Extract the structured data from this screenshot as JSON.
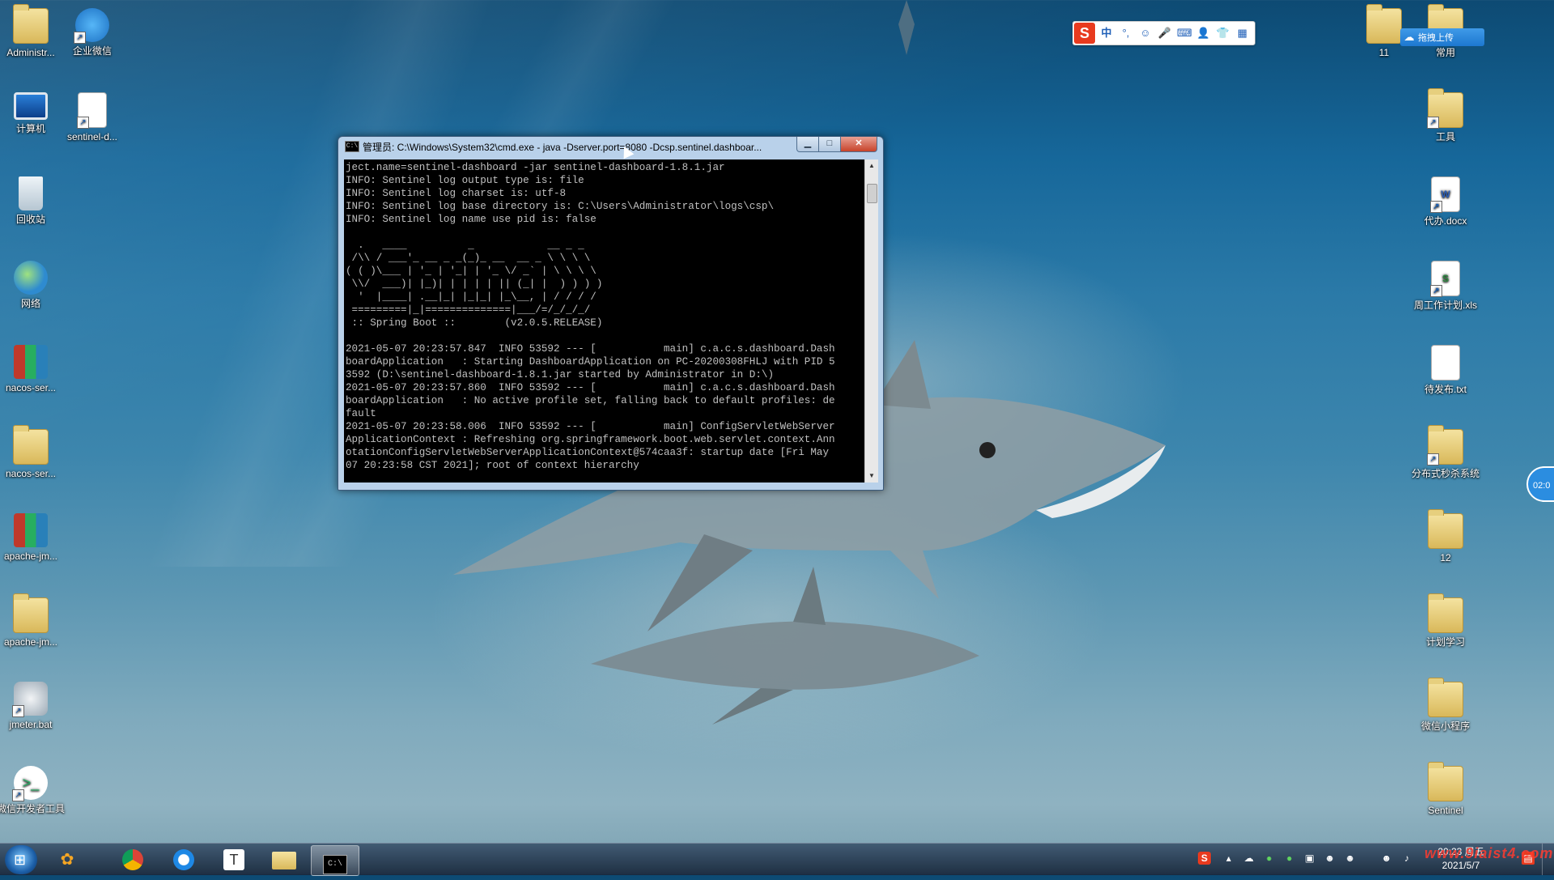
{
  "desktop": {
    "left_icons": [
      {
        "label": "Administr...",
        "kind": "folder"
      },
      {
        "label": "企业微信",
        "kind": "app"
      },
      {
        "label": "计算机",
        "kind": "computer"
      },
      {
        "label": "sentinel-d...",
        "kind": "doc"
      },
      {
        "label": "回收站",
        "kind": "recycle"
      },
      {
        "label": "网络",
        "kind": "network"
      },
      {
        "label": "nacos-ser...",
        "kind": "archive"
      },
      {
        "label": "nacos-ser...",
        "kind": "folder"
      },
      {
        "label": "apache-jm...",
        "kind": "archive"
      },
      {
        "label": "apache-jm...",
        "kind": "folder"
      },
      {
        "label": "jmeter.bat",
        "kind": "bat"
      },
      {
        "label": "微信开发者工具",
        "kind": "app"
      }
    ],
    "right_icons": [
      {
        "label": "11",
        "kind": "folder"
      },
      {
        "label": "常用",
        "kind": "folder"
      },
      {
        "label": "工具",
        "kind": "folder"
      },
      {
        "label": "代办.docx",
        "kind": "word"
      },
      {
        "label": "周工作计划.xls",
        "kind": "excel"
      },
      {
        "label": "待发布.txt",
        "kind": "txt"
      },
      {
        "label": "分布式秒杀系统",
        "kind": "folder"
      },
      {
        "label": "12",
        "kind": "folder"
      },
      {
        "label": "计划学习",
        "kind": "folder"
      },
      {
        "label": "微信小程序",
        "kind": "folder"
      },
      {
        "label": "Sentinel",
        "kind": "folder"
      }
    ]
  },
  "cloud_upload": {
    "label": "拖拽上传"
  },
  "ring_button": {
    "label": "02:0"
  },
  "ime": {
    "items": [
      "中",
      "°,",
      "☺",
      "🎤",
      "⌨",
      "👤",
      "👕",
      "▦"
    ]
  },
  "cmd_window": {
    "title": "管理员: C:\\Windows\\System32\\cmd.exe - java  -Dserver.port=8080 -Dcsp.sentinel.dashboar...",
    "console_text": "ject.name=sentinel-dashboard -jar sentinel-dashboard-1.8.1.jar\nINFO: Sentinel log output type is: file\nINFO: Sentinel log charset is: utf-8\nINFO: Sentinel log base directory is: C:\\Users\\Administrator\\logs\\csp\\\nINFO: Sentinel log name use pid is: false\n\n  .   ____          _            __ _ _\n /\\\\ / ___'_ __ _ _(_)_ __  __ _ \\ \\ \\ \\\n( ( )\\___ | '_ | '_| | '_ \\/ _` | \\ \\ \\ \\\n \\\\/  ___)| |_)| | | | | || (_| |  ) ) ) )\n  '  |____| .__|_| |_|_| |_\\__, | / / / /\n =========|_|==============|___/=/_/_/_/\n :: Spring Boot ::        (v2.0.5.RELEASE)\n\n2021-05-07 20:23:57.847  INFO 53592 --- [           main] c.a.c.s.dashboard.Dash\nboardApplication   : Starting DashboardApplication on PC-20200308FHLJ with PID 5\n3592 (D:\\sentinel-dashboard-1.8.1.jar started by Administrator in D:\\)\n2021-05-07 20:23:57.860  INFO 53592 --- [           main] c.a.c.s.dashboard.Dash\nboardApplication   : No active profile set, falling back to default profiles: de\nfault\n2021-05-07 20:23:58.006  INFO 53592 --- [           main] ConfigServletWebServer\nApplicationContext : Refreshing org.springframework.boot.web.servlet.context.Ann\notationConfigServletWebServerApplicationContext@574caa3f: startup date [Fri May\n07 20:23:58 CST 2021]; root of context hierarchy"
  },
  "taskbar": {
    "apps": [
      "start-menu",
      "colorful-app",
      "chrome",
      "qq-browser",
      "typora",
      "file-explorer",
      "cmd"
    ],
    "clock_time": "20:23 周五",
    "clock_date": "2021/5/7"
  },
  "watermark": "www.9iaist4.com"
}
